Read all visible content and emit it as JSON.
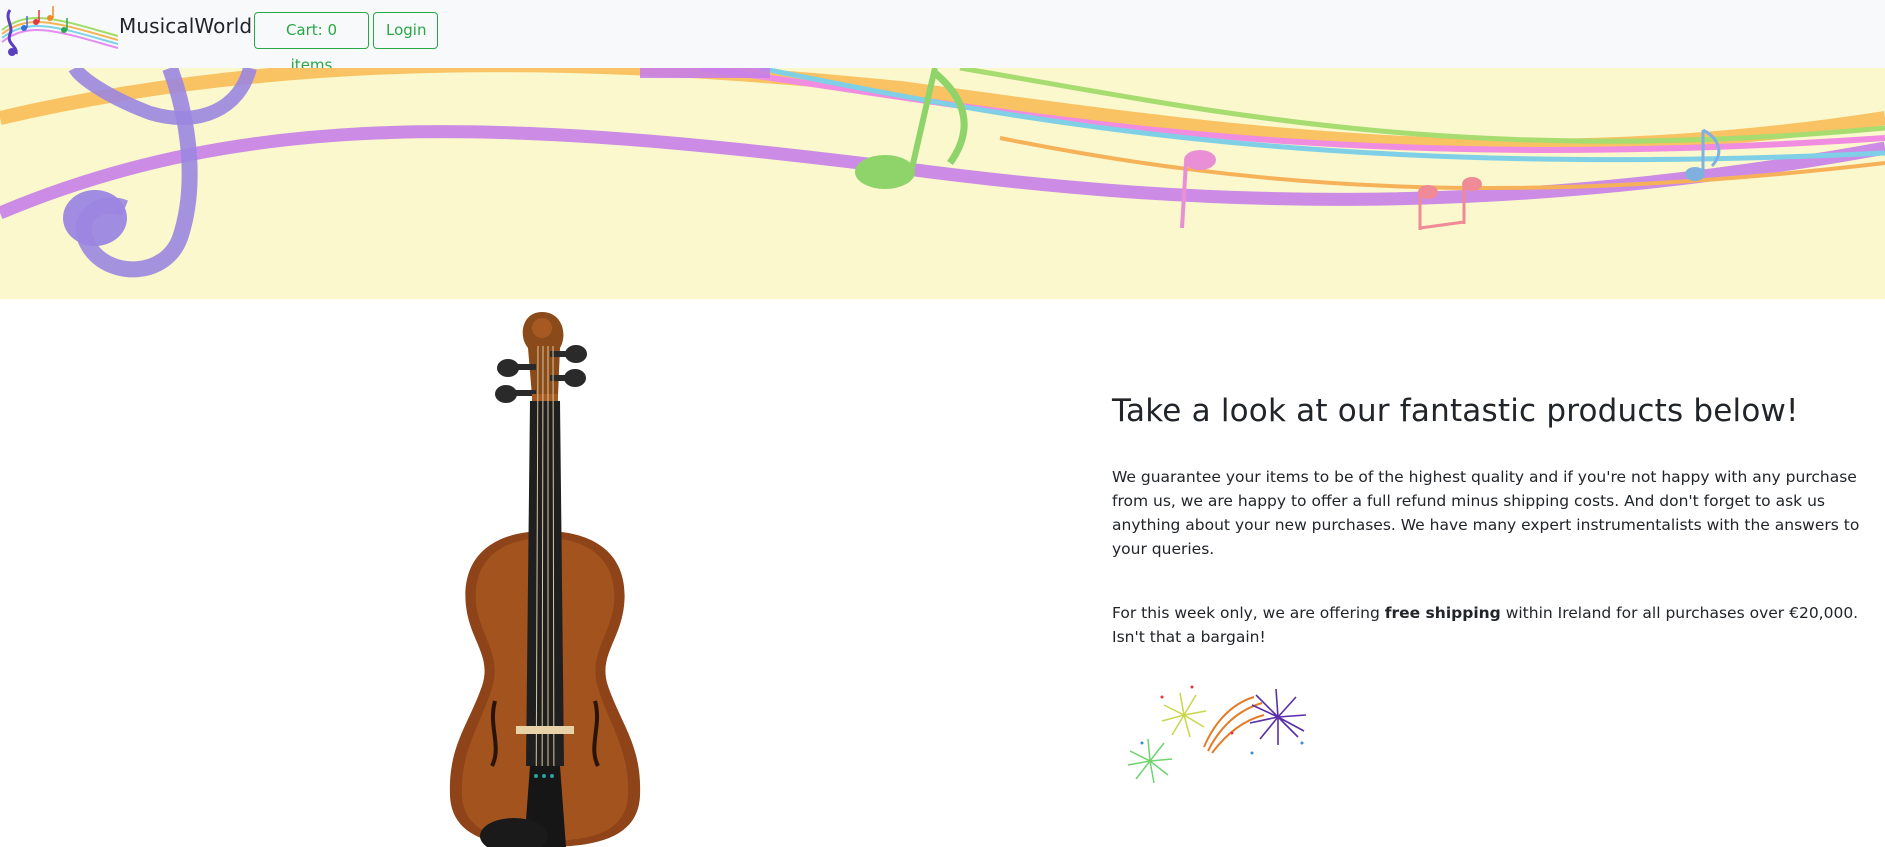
{
  "navbar": {
    "brand": "MusicalWorld",
    "cart_label": "Cart: 0 items",
    "login_label": "Login",
    "accent_color": "#28a745"
  },
  "banner": {
    "background_color": "#faf8cc",
    "icon": "music-staff-banner"
  },
  "main": {
    "product_image": "violin-image",
    "heading": "Take a look at our fantastic products below!",
    "paragraph1": "We guarantee your items to be of the highest quality and if you're not happy with any purchase from us, we are happy to offer a full refund minus shipping costs. And don't forget to ask us anything about your new purchases. We have many expert instrumentalists with the answers to your queries.",
    "offer_prefix": "For this week only, we are offering ",
    "offer_bold": "free shipping",
    "offer_suffix": " within Ireland for all purchases over €20,000.",
    "offer_line2": "Isn't that a bargain!",
    "celebration_image": "fireworks-image"
  }
}
